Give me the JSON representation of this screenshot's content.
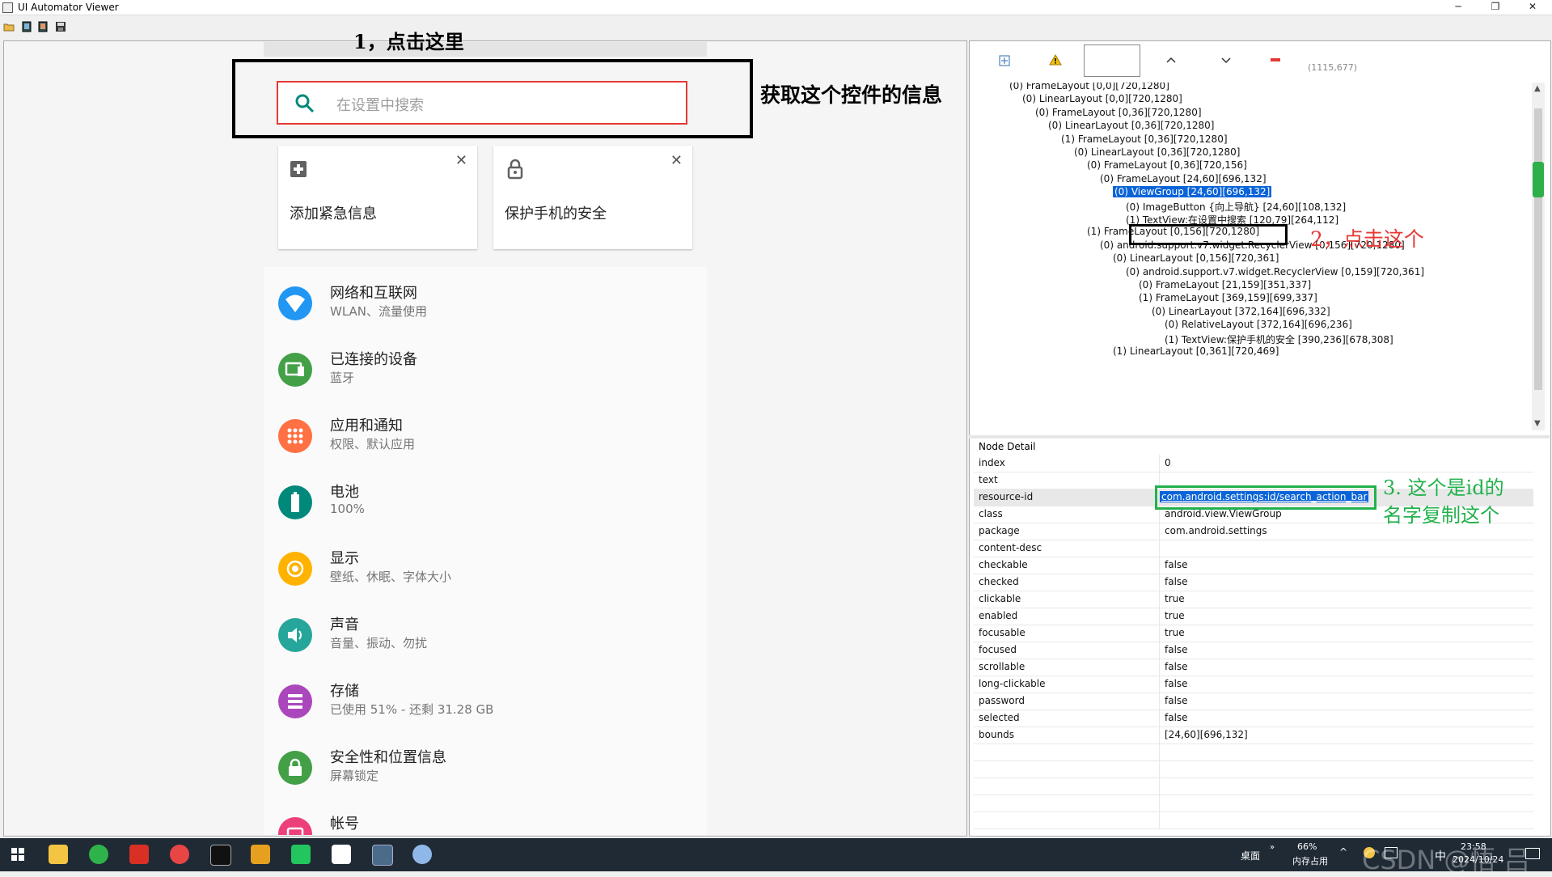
{
  "window": {
    "title": "UI Automator Viewer",
    "controls": [
      "─",
      "❐",
      "✕"
    ]
  },
  "toolbar": {
    "icons": [
      "open-icon",
      "device-screenshot-icon",
      "device-screenshot-compressed-icon",
      "save-icon"
    ]
  },
  "phone": {
    "search_placeholder": "在设置中搜索",
    "cards": [
      {
        "text": "添加紧急信息",
        "icon": "plus-square-icon"
      },
      {
        "text": "保护手机的安全",
        "icon": "lock-icon"
      }
    ],
    "settings": [
      {
        "title": "网络和互联网",
        "subtitle": "WLAN、流量使用",
        "icon": "wifi-icon",
        "color": "#2196f3"
      },
      {
        "title": "已连接的设备",
        "subtitle": "蓝牙",
        "icon": "devices-icon",
        "color": "#43a047"
      },
      {
        "title": "应用和通知",
        "subtitle": "权限、默认应用",
        "icon": "apps-icon",
        "color": "#ff7043"
      },
      {
        "title": "电池",
        "subtitle": "100%",
        "icon": "battery-icon",
        "color": "#00897b"
      },
      {
        "title": "显示",
        "subtitle": "壁纸、休眠、字体大小",
        "icon": "brightness-icon",
        "color": "#ffb300"
      },
      {
        "title": "声音",
        "subtitle": "音量、振动、勿扰",
        "icon": "volume-icon",
        "color": "#26a69a"
      },
      {
        "title": "存储",
        "subtitle": "已使用 51% - 还剩 31.28 GB",
        "icon": "storage-icon",
        "color": "#ab47bc"
      },
      {
        "title": "安全性和位置信息",
        "subtitle": "屏幕锁定",
        "icon": "lock-icon",
        "color": "#43a047"
      },
      {
        "title": "帐号",
        "subtitle": "",
        "icon": "account-icon",
        "color": "#ec407a"
      }
    ]
  },
  "annotations": {
    "step1": "1，点击这里",
    "get_info": "获取这个控件的信息",
    "step2": "2，点击这个",
    "step3_line1": "3. 这个是id的",
    "step3_line2": "名字复制这个"
  },
  "right_toolbar": {
    "coords": "(1115,677)"
  },
  "tree": [
    {
      "indent": 0,
      "text": "(0) FrameLayout [0,0][720,1280]"
    },
    {
      "indent": 1,
      "text": "(0) LinearLayout [0,0][720,1280]"
    },
    {
      "indent": 2,
      "text": "(0) FrameLayout [0,36][720,1280]"
    },
    {
      "indent": 3,
      "text": "(0) LinearLayout [0,36][720,1280]"
    },
    {
      "indent": 4,
      "text": "(1) FrameLayout [0,36][720,1280]"
    },
    {
      "indent": 5,
      "text": "(0) LinearLayout [0,36][720,1280]"
    },
    {
      "indent": 6,
      "text": "(0) FrameLayout [0,36][720,156]"
    },
    {
      "indent": 7,
      "text": "(0) FrameLayout [24,60][696,132]"
    },
    {
      "indent": 8,
      "text": "(0) ViewGroup [24,60][696,132]",
      "selected": true
    },
    {
      "indent": 9,
      "text": "(0) ImageButton {向上导航} [24,60][108,132]"
    },
    {
      "indent": 9,
      "text": "(1) TextView:在设置中搜索 [120,79][264,112]"
    },
    {
      "indent": 6,
      "text": "(1) FrameLayout [0,156][720,1280]"
    },
    {
      "indent": 7,
      "text": "(0) android.support.v7.widget.RecyclerView [0,156][720,1280]"
    },
    {
      "indent": 8,
      "text": "(0) LinearLayout [0,156][720,361]"
    },
    {
      "indent": 9,
      "text": "(0) android.support.v7.widget.RecyclerView [0,159][720,361]"
    },
    {
      "indent": 10,
      "text": "(0) FrameLayout [21,159][351,337]"
    },
    {
      "indent": 10,
      "text": "(1) FrameLayout [369,159][699,337]"
    },
    {
      "indent": 11,
      "text": "(0) LinearLayout [372,164][696,332]"
    },
    {
      "indent": 12,
      "text": "(0) RelativeLayout [372,164][696,236]"
    },
    {
      "indent": 12,
      "text": "(1) TextView:保护手机的安全 [390,236][678,308]"
    },
    {
      "indent": 8,
      "text": "(1) LinearLayout [0,361][720,469]"
    }
  ],
  "node_detail": {
    "header": "Node Detail",
    "rows": [
      {
        "key": "index",
        "value": "0"
      },
      {
        "key": "text",
        "value": ""
      },
      {
        "key": "resource-id",
        "value": "com.android.settings:id/search_action_bar",
        "selected": true
      },
      {
        "key": "class",
        "value": "android.view.ViewGroup"
      },
      {
        "key": "package",
        "value": "com.android.settings"
      },
      {
        "key": "content-desc",
        "value": ""
      },
      {
        "key": "checkable",
        "value": "false"
      },
      {
        "key": "checked",
        "value": "false"
      },
      {
        "key": "clickable",
        "value": "true"
      },
      {
        "key": "enabled",
        "value": "true"
      },
      {
        "key": "focusable",
        "value": "true"
      },
      {
        "key": "focused",
        "value": "false"
      },
      {
        "key": "scrollable",
        "value": "false"
      },
      {
        "key": "long-clickable",
        "value": "false"
      },
      {
        "key": "password",
        "value": "false"
      },
      {
        "key": "selected",
        "value": "false"
      },
      {
        "key": "bounds",
        "value": "[24,60][696,132]"
      }
    ]
  },
  "taskbar": {
    "desktop_label": "桌面",
    "memory_percent": "66%",
    "memory_label": "内存占用",
    "time": "23:58",
    "date": "2024/10/24",
    "ime": "中",
    "watermark": "CSDN @悟 吕"
  }
}
